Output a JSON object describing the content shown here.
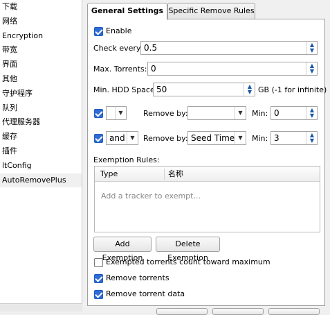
{
  "sidebar": {
    "items": [
      {
        "label": "下载"
      },
      {
        "label": "网络"
      },
      {
        "label": "Encryption"
      },
      {
        "label": "带宽"
      },
      {
        "label": "界面"
      },
      {
        "label": "其他"
      },
      {
        "label": "守护程序"
      },
      {
        "label": "队列"
      },
      {
        "label": "代理服务器"
      },
      {
        "label": "缓存"
      },
      {
        "label": "插件"
      },
      {
        "label": "ltConfig"
      },
      {
        "label": "AutoRemovePlus"
      }
    ],
    "selected": "AutoRemovePlus"
  },
  "tabs": {
    "general": "General Settings",
    "specific": "Specific Remove Rules"
  },
  "general": {
    "enable_label": "Enable",
    "check_every_label": "Check every:",
    "check_every_value": "0.5",
    "max_torrents_label": "Max. Torrents:",
    "max_torrents_value": "0",
    "min_hdd_label": "Min. HDD Space:",
    "min_hdd_value": "50",
    "min_hdd_unit": "GB (-1 for infinite)",
    "rule1": {
      "logic": "",
      "remove_by_label": "Remove by:",
      "remove_by_value": "",
      "min_label": "Min:",
      "min_value": "0"
    },
    "rule2": {
      "logic": "and",
      "remove_by_label": "Remove by:",
      "remove_by_value": "Seed Time",
      "min_label": "Min:",
      "min_value": "3"
    },
    "exemption_rules_label": "Exemption Rules:",
    "table": {
      "col_type": "Type",
      "col_name": "名称",
      "placeholder": "Add a tracker to exempt..."
    },
    "add_exemption": "Add Exemption",
    "delete_exemption": "Delete Exemption",
    "exempted_count_label": "Exempted torrents count toward maximum",
    "remove_torrents_label": "Remove torrents",
    "remove_data_label": "Remove torrent data"
  }
}
